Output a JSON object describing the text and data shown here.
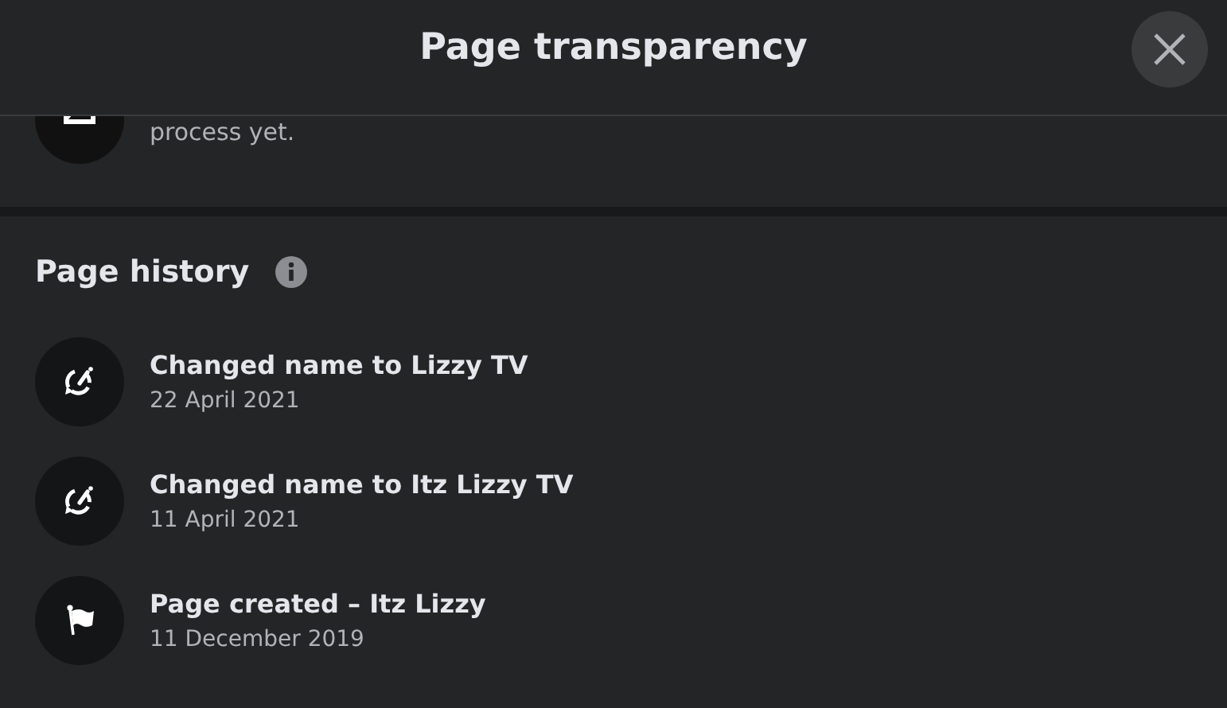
{
  "dialog": {
    "title": "Page transparency"
  },
  "partial_item": {
    "text": "process yet."
  },
  "page_history": {
    "heading": "Page history",
    "items": [
      {
        "kind": "rename",
        "title": "Changed name to Lizzy TV",
        "date": "22 April 2021"
      },
      {
        "kind": "rename",
        "title": "Changed name to Itz Lizzy TV",
        "date": "11 April 2021"
      },
      {
        "kind": "flag",
        "title": "Page created – Itz Lizzy",
        "date": "11 December 2019"
      }
    ]
  }
}
